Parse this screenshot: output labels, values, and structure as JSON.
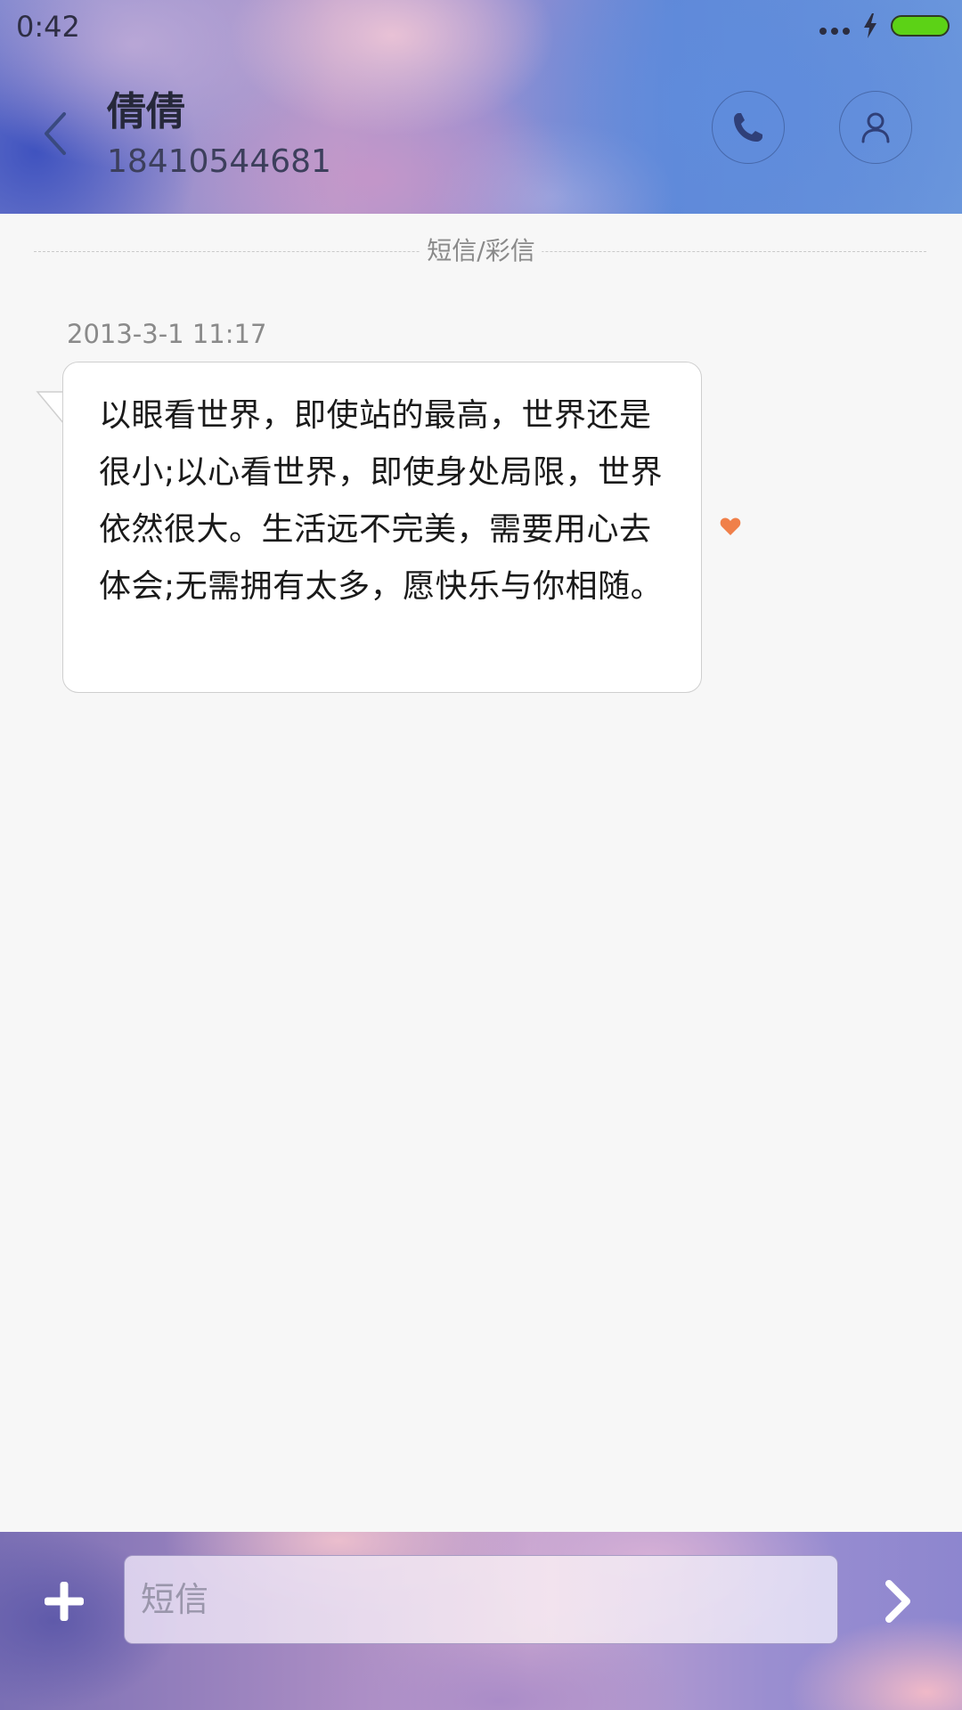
{
  "status_bar": {
    "time": "0:42"
  },
  "header": {
    "contact_name": "倩倩",
    "contact_number": "18410544681",
    "icons": {
      "back": "chevron-left-icon",
      "call": "phone-icon",
      "contact": "person-icon"
    }
  },
  "conversation": {
    "divider_label": "短信/彩信",
    "messages": [
      {
        "timestamp": "2013-3-1 11:17",
        "text": "以眼看世界，即使站的最高，世界还是很小;以心看世界，即使身处局限，世界依然很大。生活远不完美，需要用心去体会;无需拥有太多，愿快乐与你相随。",
        "favorite_icon": "heart-icon"
      }
    ]
  },
  "composer": {
    "placeholder": "短信",
    "value": "",
    "icons": {
      "attach": "plus-icon",
      "send": "chevron-right-icon"
    }
  },
  "colors": {
    "accent_heart": "#f0804a",
    "battery_fill": "#5cd216"
  }
}
